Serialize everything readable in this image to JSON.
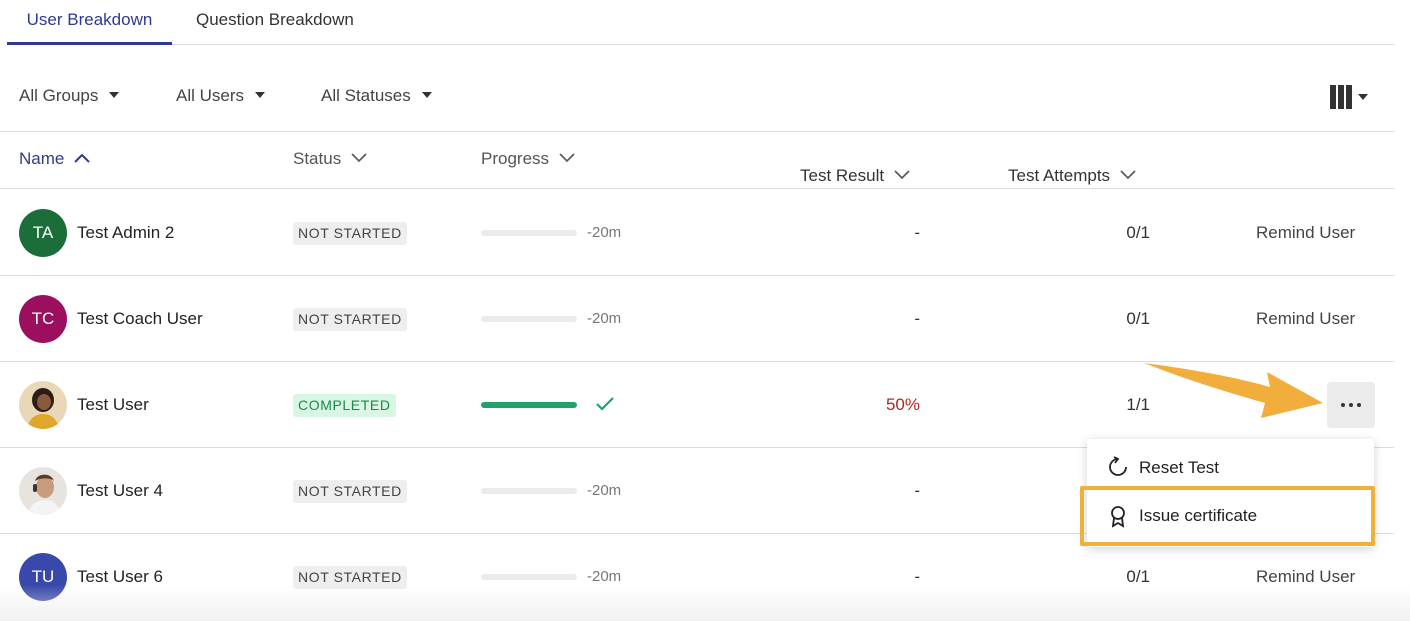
{
  "tabs": [
    {
      "label": "User Breakdown",
      "active": true
    },
    {
      "label": "Question Breakdown",
      "active": false
    }
  ],
  "filters": {
    "groups": "All Groups",
    "users": "All Users",
    "statuses": "All Statuses"
  },
  "columns": {
    "name": "Name",
    "status": "Status",
    "progress": "Progress",
    "test_result": "Test Result",
    "test_attempts": "Test Attempts"
  },
  "rows": [
    {
      "initials": "TA",
      "avatar_color": "#1b6e3a",
      "name": "Test Admin 2",
      "status": "NOT STARTED",
      "progress": 0,
      "time": "-20m",
      "result": "-",
      "attempts": "0/1",
      "action": "Remind User"
    },
    {
      "initials": "TC",
      "avatar_color": "#9c0f5f",
      "name": "Test Coach User",
      "status": "NOT STARTED",
      "progress": 0,
      "time": "-20m",
      "result": "-",
      "attempts": "0/1",
      "action": "Remind User"
    },
    {
      "initials": "",
      "avatar_color": "#c9a060",
      "name": "Test User",
      "status": "COMPLETED",
      "progress": 1.0,
      "time": "",
      "result": "50%",
      "attempts": "1/1",
      "action": ""
    },
    {
      "initials": "",
      "avatar_color": "#d8c9b8",
      "name": "Test User 4",
      "status": "NOT STARTED",
      "progress": 0,
      "time": "-20m",
      "result": "-",
      "attempts": "",
      "action": ""
    },
    {
      "initials": "TU",
      "avatar_color": "#3949ab",
      "name": "Test User 6",
      "status": "NOT STARTED",
      "progress": 0,
      "time": "-20m",
      "result": "-",
      "attempts": "0/1",
      "action": "Remind User"
    }
  ],
  "menu": {
    "reset": "Reset Test",
    "issue": "Issue certificate"
  },
  "colors": {
    "accent": "#2f3a8f",
    "success": "#1fa36a",
    "fail": "#b3261e",
    "highlight": "#f0b03c"
  }
}
